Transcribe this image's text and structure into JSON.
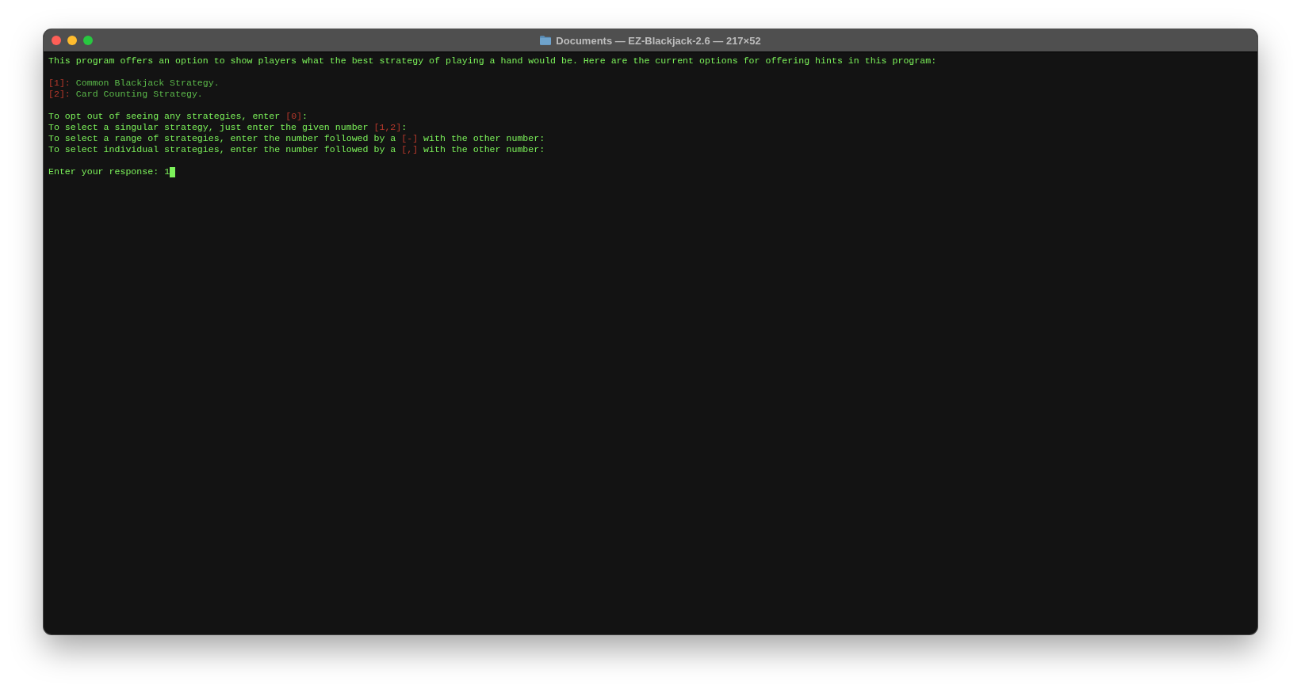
{
  "window": {
    "title": "Documents — EZ-Blackjack-2.6 — 217×52"
  },
  "terminal": {
    "paragraphs": [
      {
        "lines": [
          {
            "segments": [
              {
                "kind": "text",
                "text": "This program offers an option to show players what the best strategy of playing a hand would be. Here are the current options for offering hints in this program:"
              }
            ]
          }
        ]
      },
      {
        "lines": [
          {
            "segments": [
              {
                "kind": "key",
                "text": "[1]:"
              },
              {
                "kind": "dim",
                "text": " Common Blackjack Strategy."
              }
            ]
          },
          {
            "segments": [
              {
                "kind": "key",
                "text": "[2]:"
              },
              {
                "kind": "dim",
                "text": " Card Counting Strategy."
              }
            ]
          }
        ]
      },
      {
        "lines": [
          {
            "segments": [
              {
                "kind": "text",
                "text": "To opt out of seeing any strategies, enter "
              },
              {
                "kind": "key",
                "text": "[0]"
              },
              {
                "kind": "text",
                "text": ":"
              }
            ]
          },
          {
            "segments": [
              {
                "kind": "text",
                "text": "To select a singular strategy, just enter the given number "
              },
              {
                "kind": "key",
                "text": "[1,2]"
              },
              {
                "kind": "text",
                "text": ":"
              }
            ]
          },
          {
            "segments": [
              {
                "kind": "text",
                "text": "To select a range of strategies, enter the number followed by a "
              },
              {
                "kind": "key",
                "text": "[-]"
              },
              {
                "kind": "text",
                "text": " with the other number:"
              }
            ]
          },
          {
            "segments": [
              {
                "kind": "text",
                "text": "To select individual strategies, enter the number followed by a "
              },
              {
                "kind": "key",
                "text": "[,]"
              },
              {
                "kind": "text",
                "text": " with the other number:"
              }
            ]
          }
        ]
      }
    ],
    "prompt": {
      "label": "Enter your response:",
      "value": "1"
    }
  }
}
